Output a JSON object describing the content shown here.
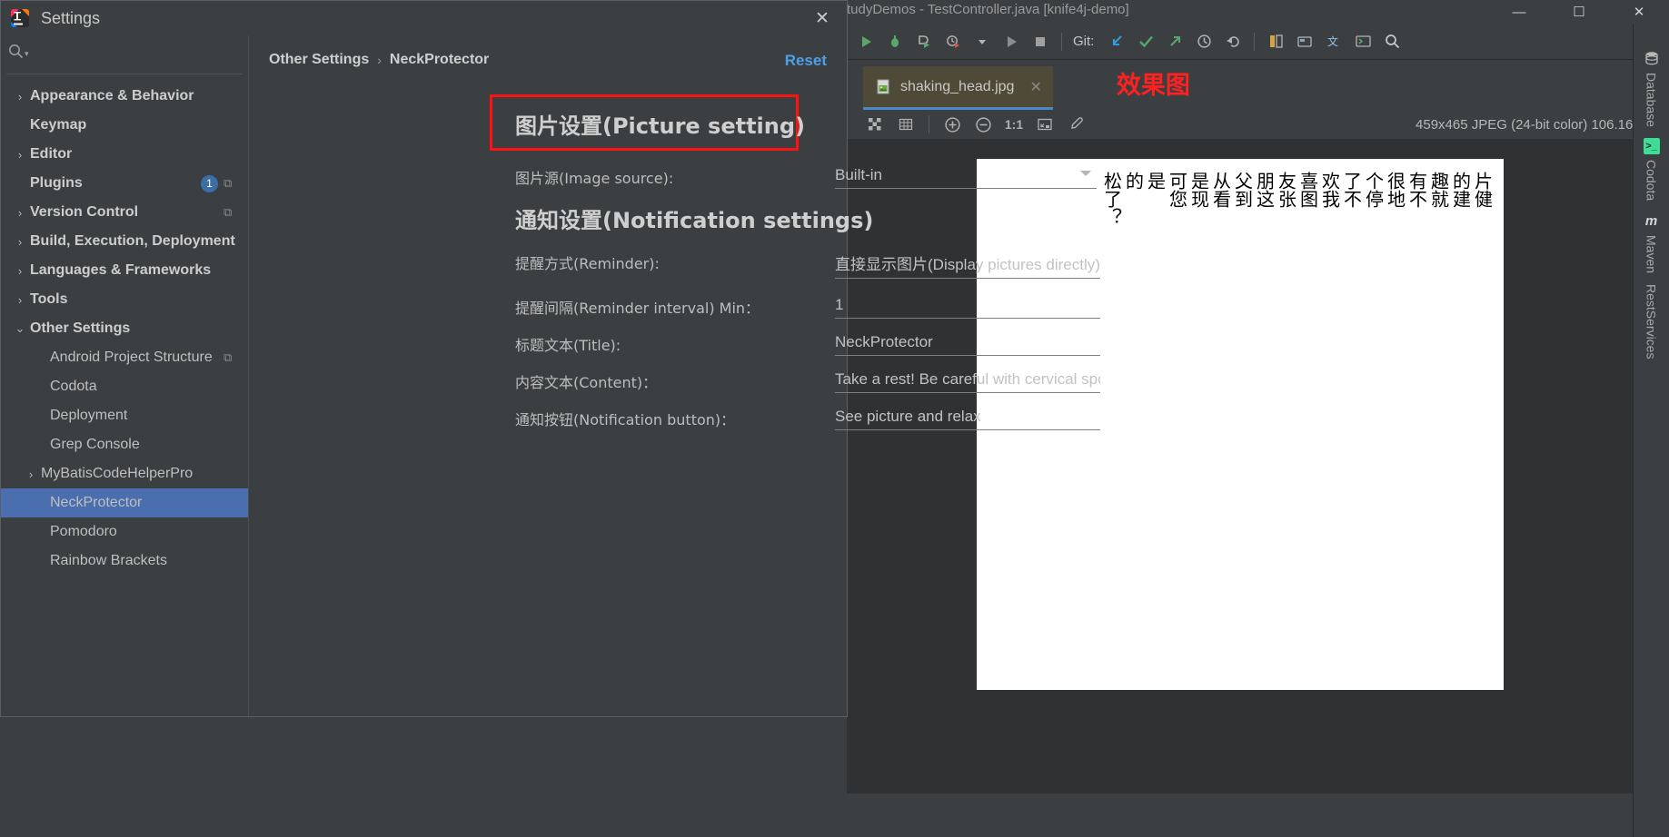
{
  "ide": {
    "title": "tudyDemos - TestController.java [knife4j-demo]",
    "window_buttons": {
      "minimize": "—",
      "maximize": "☐",
      "close": "✕"
    },
    "toolbar": {
      "run_icon": "run-icon",
      "debug_icon": "debug-icon",
      "coverage_icon": "run-with-coverage-icon",
      "profile_icon": "profile-icon",
      "dropdown_icon": "chevron-down-icon",
      "run_alt_icon": "run-alt-icon",
      "stop_icon": "stop-icon",
      "git_label": "Git:",
      "update_icon": "git-update-icon",
      "commit_icon": "git-commit-icon",
      "push_icon": "git-push-icon",
      "history_icon": "history-icon",
      "rollback_icon": "rollback-icon",
      "diff_icon": "diff-icon",
      "project_icon": "project-structure-icon",
      "translate_icon": "translate-icon",
      "terminal_icon": "terminal-icon",
      "search_icon": "search-everywhere-icon"
    },
    "editor_tab": {
      "filename": "shaking_head.jpg",
      "close": "✕",
      "file_icon": "image-file-icon"
    },
    "annotation": "效果图",
    "image_toolbar": {
      "grid_icon": "transparency-grid-icon",
      "chessboard_icon": "grid-icon",
      "zoom_in_icon": "zoom-in-icon",
      "zoom_out_icon": "zoom-out-icon",
      "actual_size_label": "1:1",
      "fit_icon": "fit-to-window-icon",
      "picker_icon": "color-picker-icon",
      "info": "459x465 JPEG (24-bit color) 106.16 kB"
    },
    "image_text_columns": [
      "片健",
      "的建",
      "趣就",
      "有不",
      "很地",
      "个停",
      "了不",
      "欢我",
      "喜图",
      "友张",
      "朋这",
      "父到",
      "从看",
      "是现",
      "可您",
      "是",
      "的",
      "松了？"
    ],
    "right_rail": [
      {
        "label": "Database",
        "icon": "database-icon"
      },
      {
        "label": "Codota",
        "icon": "codota-icon"
      },
      {
        "label": "Maven",
        "icon": "maven-icon"
      },
      {
        "label": "RestServices",
        "icon": "rest-services-icon"
      }
    ]
  },
  "settings": {
    "window_title": "Settings",
    "logo_icon": "intellij-idea-icon",
    "close_icon": "close-icon",
    "search": {
      "icon": "search-icon",
      "caret": "▾",
      "placeholder": ""
    },
    "tree": [
      {
        "label": "Appearance & Behavior",
        "twisty": "›",
        "bold": true,
        "indent": 0,
        "selected": false
      },
      {
        "label": "Keymap",
        "twisty": "",
        "bold": true,
        "indent": 0,
        "selected": false
      },
      {
        "label": "Editor",
        "twisty": "›",
        "bold": true,
        "indent": 0,
        "selected": false
      },
      {
        "label": "Plugins",
        "twisty": "",
        "bold": true,
        "indent": 0,
        "selected": false,
        "badge": "1",
        "copy": true
      },
      {
        "label": "Version Control",
        "twisty": "›",
        "bold": true,
        "indent": 0,
        "selected": false,
        "copy": true
      },
      {
        "label": "Build, Execution, Deployment",
        "twisty": "›",
        "bold": true,
        "indent": 0,
        "selected": false
      },
      {
        "label": "Languages & Frameworks",
        "twisty": "›",
        "bold": true,
        "indent": 0,
        "selected": false
      },
      {
        "label": "Tools",
        "twisty": "›",
        "bold": true,
        "indent": 0,
        "selected": false
      },
      {
        "label": "Other Settings",
        "twisty": "⌄",
        "bold": true,
        "indent": 0,
        "selected": false
      },
      {
        "label": "Android Project Structure",
        "twisty": "",
        "bold": false,
        "indent": 1,
        "selected": false,
        "copy": true
      },
      {
        "label": "Codota",
        "twisty": "",
        "bold": false,
        "indent": 1,
        "selected": false
      },
      {
        "label": "Deployment",
        "twisty": "",
        "bold": false,
        "indent": 1,
        "selected": false
      },
      {
        "label": "Grep Console",
        "twisty": "",
        "bold": false,
        "indent": 1,
        "selected": false
      },
      {
        "label": "MyBatisCodeHelperPro",
        "twisty": "›",
        "bold": false,
        "indent": 2,
        "selected": false
      },
      {
        "label": "NeckProtector",
        "twisty": "",
        "bold": false,
        "indent": 1,
        "selected": true
      },
      {
        "label": "Pomodoro",
        "twisty": "",
        "bold": false,
        "indent": 1,
        "selected": false
      },
      {
        "label": "Rainbow Brackets",
        "twisty": "",
        "bold": false,
        "indent": 1,
        "selected": false
      }
    ],
    "breadcrumb": {
      "parent": "Other Settings",
      "separator": "›",
      "current": "NeckProtector"
    },
    "reset_label": "Reset",
    "picture_section_title": "图片设置(Picture setting)",
    "notification_section_title": "通知设置(Notification settings)",
    "fields": [
      {
        "label": "图片源(Image source):",
        "value": "Built-in",
        "type": "combo"
      },
      {
        "label": "提醒方式(Reminder):",
        "value": "直接显示图片(Display pictures directly)",
        "type": "combo"
      },
      {
        "label": "提醒间隔(Reminder interval) Min：",
        "value": "1",
        "type": "text"
      },
      {
        "label": "标题文本(Title):",
        "value": "NeckProtector",
        "type": "text"
      },
      {
        "label": "内容文本(Content)：",
        "value": "Take a rest! Be careful with cervical spo",
        "type": "text"
      },
      {
        "label": "通知按钮(Notification button)：",
        "value": "See picture and relax",
        "type": "text"
      }
    ]
  }
}
